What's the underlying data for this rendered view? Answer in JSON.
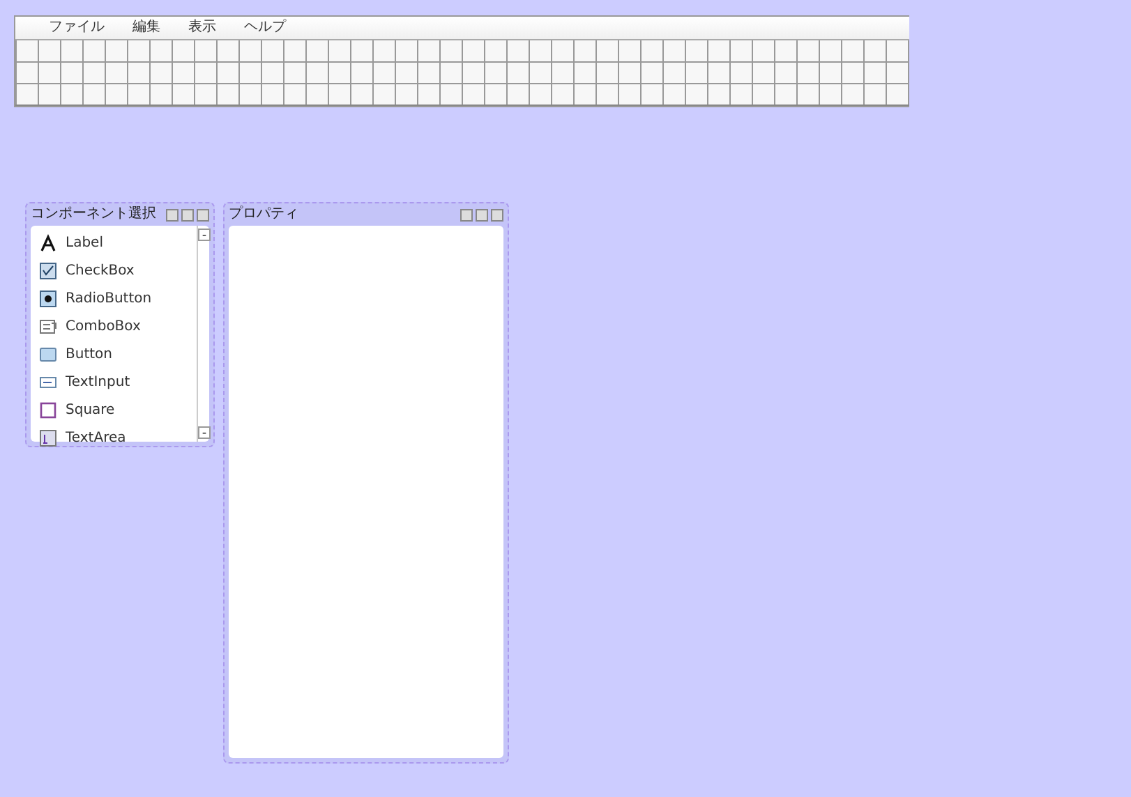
{
  "menu": [
    {
      "label": "ファイル"
    },
    {
      "label": "編集"
    },
    {
      "label": "表示"
    },
    {
      "label": "ヘルプ"
    }
  ],
  "component_panel": {
    "title": "コンポーネント選択",
    "items": [
      {
        "label": "Label",
        "kind": "label"
      },
      {
        "label": "CheckBox",
        "kind": "checkbox"
      },
      {
        "label": "RadioButton",
        "kind": "radio"
      },
      {
        "label": "ComboBox",
        "kind": "combo"
      },
      {
        "label": "Button",
        "kind": "button"
      },
      {
        "label": "TextInput",
        "kind": "textinput"
      },
      {
        "label": "Square",
        "kind": "square"
      },
      {
        "label": "TextArea",
        "kind": "textarea"
      }
    ]
  },
  "property_panel": {
    "title": "プロパティ"
  }
}
